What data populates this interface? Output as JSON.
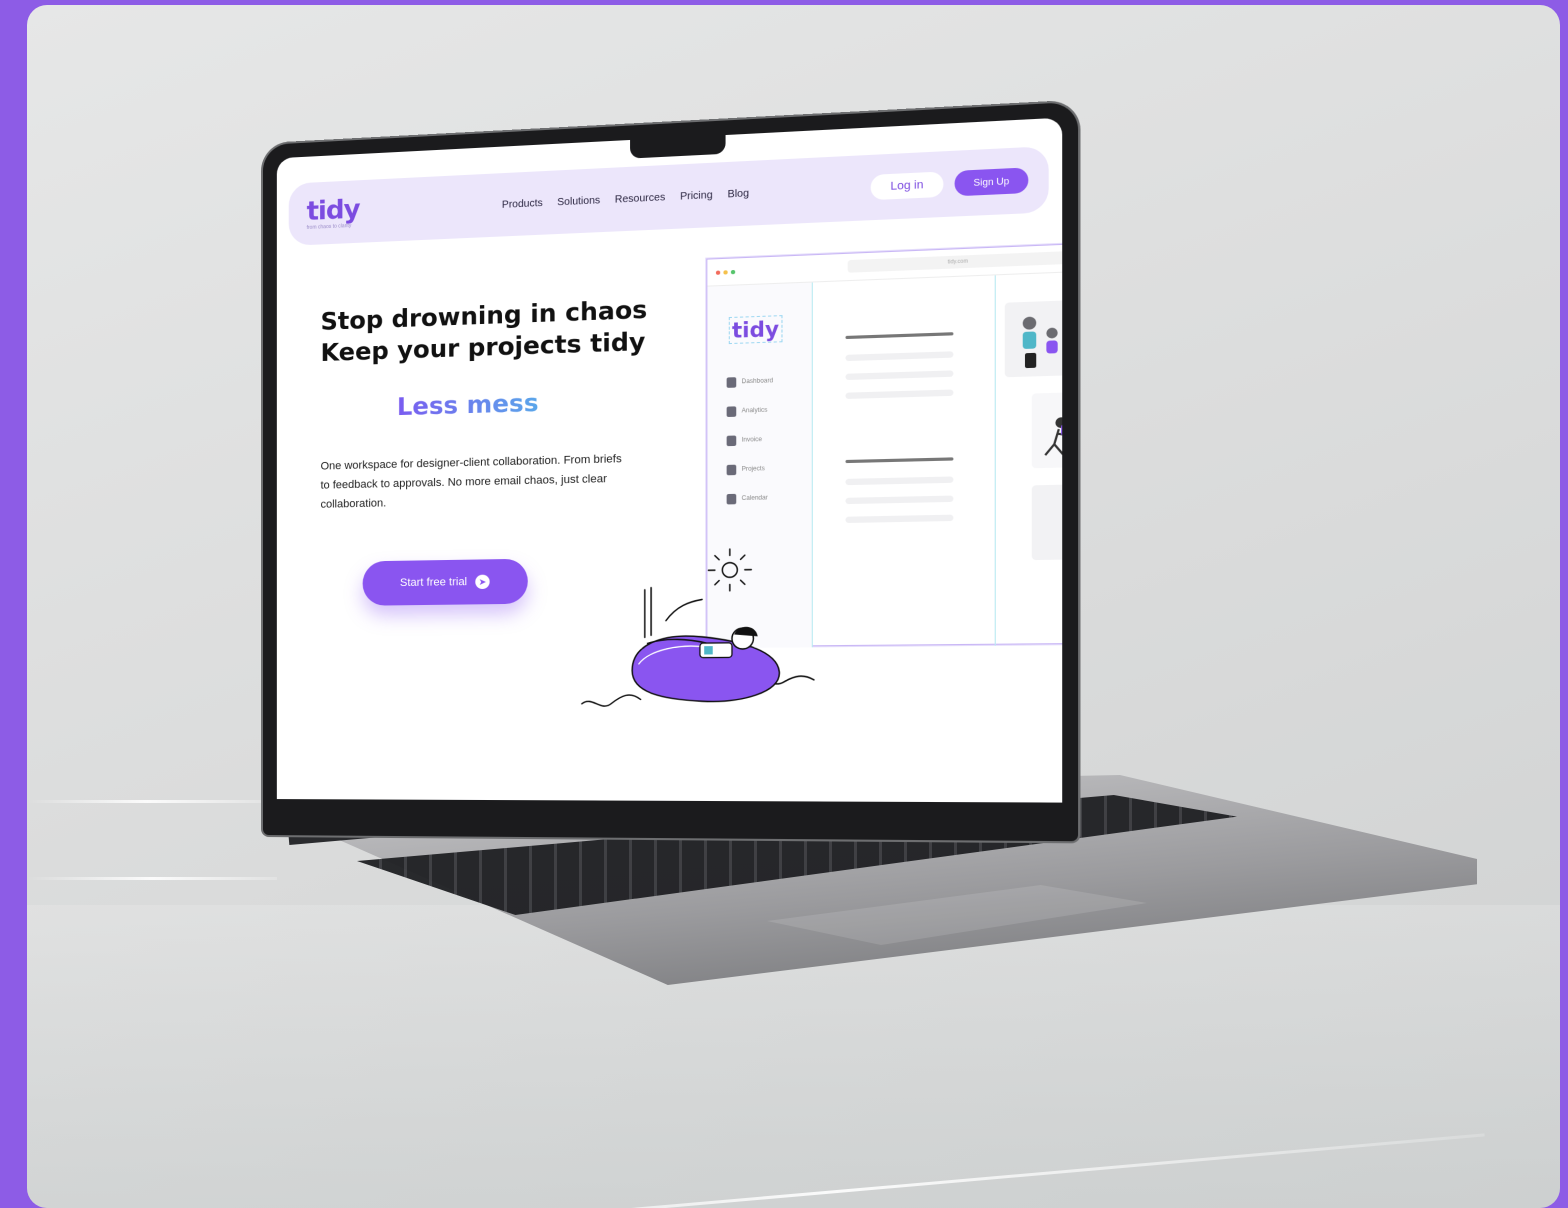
{
  "site": {
    "logo": "tidy",
    "logo_tagline": "from chaos to clarity",
    "nav": [
      "Products",
      "Solutions",
      "Resources",
      "Pricing",
      "Blog"
    ],
    "login_label": "Log in",
    "signup_label": "Sign Up"
  },
  "hero": {
    "headline_1": "Stop drowning in chaos",
    "headline_2": "Keep your projects tidy",
    "accent": "Less mess",
    "description": "One workspace for designer-client collaboration. From briefs to feedback to approvals. No more email chaos, just clear collaboration.",
    "cta_label": "Start free trial",
    "cta_icon": "arrow-right-circle-icon"
  },
  "mockup": {
    "url": "tidy.com",
    "logo": "tidy",
    "sidebar": [
      {
        "label": "Dashboard",
        "icon": "grid-icon"
      },
      {
        "label": "Analytics",
        "icon": "chart-icon"
      },
      {
        "label": "Invoice",
        "icon": "invoice-icon"
      },
      {
        "label": "Projects",
        "icon": "document-icon"
      },
      {
        "label": "Calendar",
        "icon": "calendar-icon"
      }
    ]
  },
  "colors": {
    "brand": "#8a55f0",
    "nav_bg": "#ece6fb",
    "frame": "#8d5ce6"
  }
}
